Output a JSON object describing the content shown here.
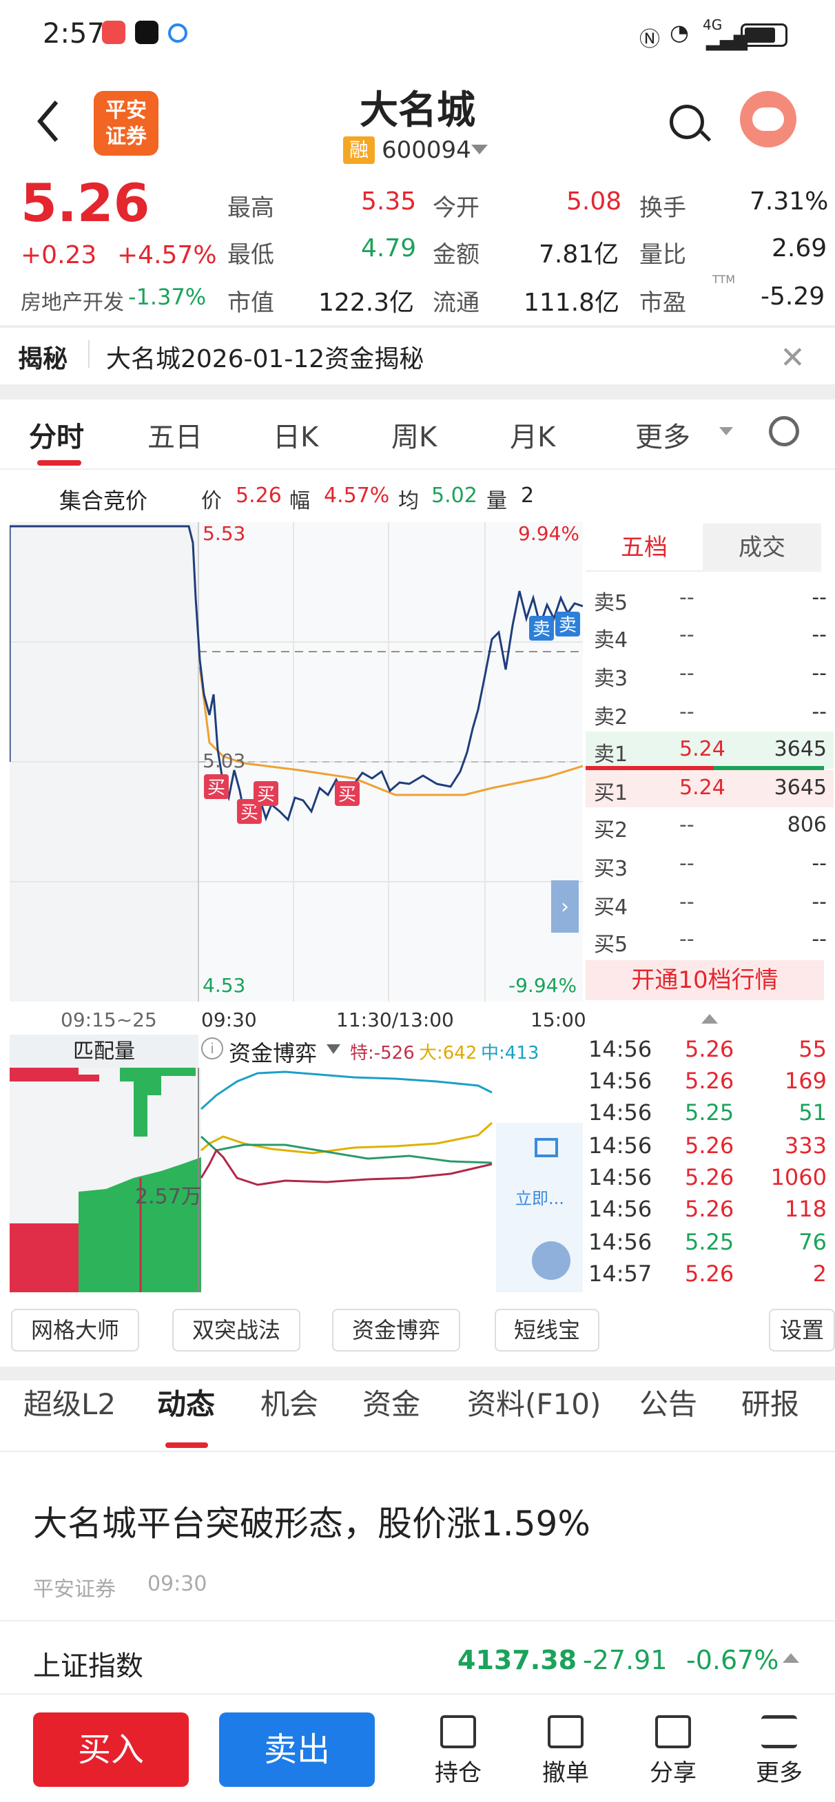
{
  "status": {
    "time": "2:57",
    "network": "4G"
  },
  "header": {
    "name": "大名城",
    "margin_badge": "融",
    "code": "600094",
    "broker_logo_line1": "平安",
    "broker_logo_line2": "证券"
  },
  "quote": {
    "price": "5.26",
    "change": "+0.23",
    "change_pct": "+4.57%",
    "sector": "房地产开发",
    "sector_pct": "-1.37%",
    "high_label": "最高",
    "high": "5.35",
    "open_label": "今开",
    "open": "5.08",
    "turnover_label": "换手",
    "turnover": "7.31%",
    "low_label": "最低",
    "low": "4.79",
    "amount_label": "金额",
    "amount": "7.81亿",
    "volratio_label": "量比",
    "volratio": "2.69",
    "mcap_label": "市值",
    "mcap": "122.3亿",
    "float_label": "流通",
    "float": "111.8亿",
    "pe_label": "市盈",
    "pe_sup": "TTM",
    "pe": "-5.29"
  },
  "reveal": {
    "label": "揭秘",
    "text": "大名城2026-01-12资金揭秘"
  },
  "tabs": [
    "分时",
    "五日",
    "日K",
    "周K",
    "月K",
    "更多"
  ],
  "info_bar": {
    "auction": "集合竞价",
    "price_label": "价",
    "price": "5.26",
    "pct_label": "幅",
    "pct": "4.57%",
    "avg_label": "均",
    "avg": "5.02",
    "vol_label": "量",
    "vol": "2"
  },
  "chart_labels": {
    "top_price": "5.53",
    "top_pct": "9.94%",
    "mid_price": "5.03",
    "bottom_price": "4.53",
    "bottom_pct": "-9.94%",
    "t0": "09:15~25",
    "t1": "09:30",
    "t2": "11:30/13:00",
    "t3": "15:00"
  },
  "markers": {
    "buy": "买",
    "sell": "卖"
  },
  "orderbook": {
    "tab_five": "五档",
    "tab_trades": "成交",
    "rows": [
      {
        "l": "卖5",
        "p": "--",
        "v": "--"
      },
      {
        "l": "卖4",
        "p": "--",
        "v": "--"
      },
      {
        "l": "卖3",
        "p": "--",
        "v": "--"
      },
      {
        "l": "卖2",
        "p": "--",
        "v": "--"
      },
      {
        "l": "卖1",
        "p": "5.24",
        "v": "3645"
      },
      {
        "l": "买1",
        "p": "5.24",
        "v": "3645"
      },
      {
        "l": "买2",
        "p": "--",
        "v": "806"
      },
      {
        "l": "买3",
        "p": "--",
        "v": "--"
      },
      {
        "l": "买4",
        "p": "--",
        "v": "--"
      },
      {
        "l": "买5",
        "p": "--",
        "v": "--"
      }
    ],
    "upgrade": "开通10档行情"
  },
  "lower": {
    "match": "匹配量",
    "capital": "资金博弈",
    "special": "特:-526",
    "large": "大:642",
    "medium": "中:413",
    "vol_label": "2.57万",
    "unlock": "立即..."
  },
  "ticks": [
    {
      "t": "14:56",
      "p": "5.26",
      "v": "55"
    },
    {
      "t": "14:56",
      "p": "5.26",
      "v": "169"
    },
    {
      "t": "14:56",
      "p": "5.25",
      "v": "51"
    },
    {
      "t": "14:56",
      "p": "5.26",
      "v": "333"
    },
    {
      "t": "14:56",
      "p": "5.26",
      "v": "1060"
    },
    {
      "t": "14:56",
      "p": "5.26",
      "v": "118"
    },
    {
      "t": "14:56",
      "p": "5.25",
      "v": "76"
    },
    {
      "t": "14:57",
      "p": "5.26",
      "v": "2"
    }
  ],
  "tools": [
    "网格大师",
    "双突战法",
    "资金博弈",
    "短线宝",
    "设置"
  ],
  "bottom_tabs": [
    "超级L2",
    "动态",
    "机会",
    "资金",
    "资料(F10)",
    "公告",
    "研报"
  ],
  "news": {
    "title": "大名城平台突破形态，股价涨1.59%",
    "source": "平安证券",
    "time": "09:30"
  },
  "index": {
    "name": "上证指数",
    "value": "4137.38",
    "change": "-27.91",
    "pct": "-0.67%"
  },
  "actions": {
    "buy": "买入",
    "sell": "卖出",
    "hold": "持仓",
    "cancel": "撤单",
    "share": "分享",
    "more": "更多"
  },
  "colors": {
    "up": "#e4262f",
    "down": "#1aa35a",
    "buy_btn": "#e6212c",
    "sell_btn": "#1d7ce8"
  }
}
